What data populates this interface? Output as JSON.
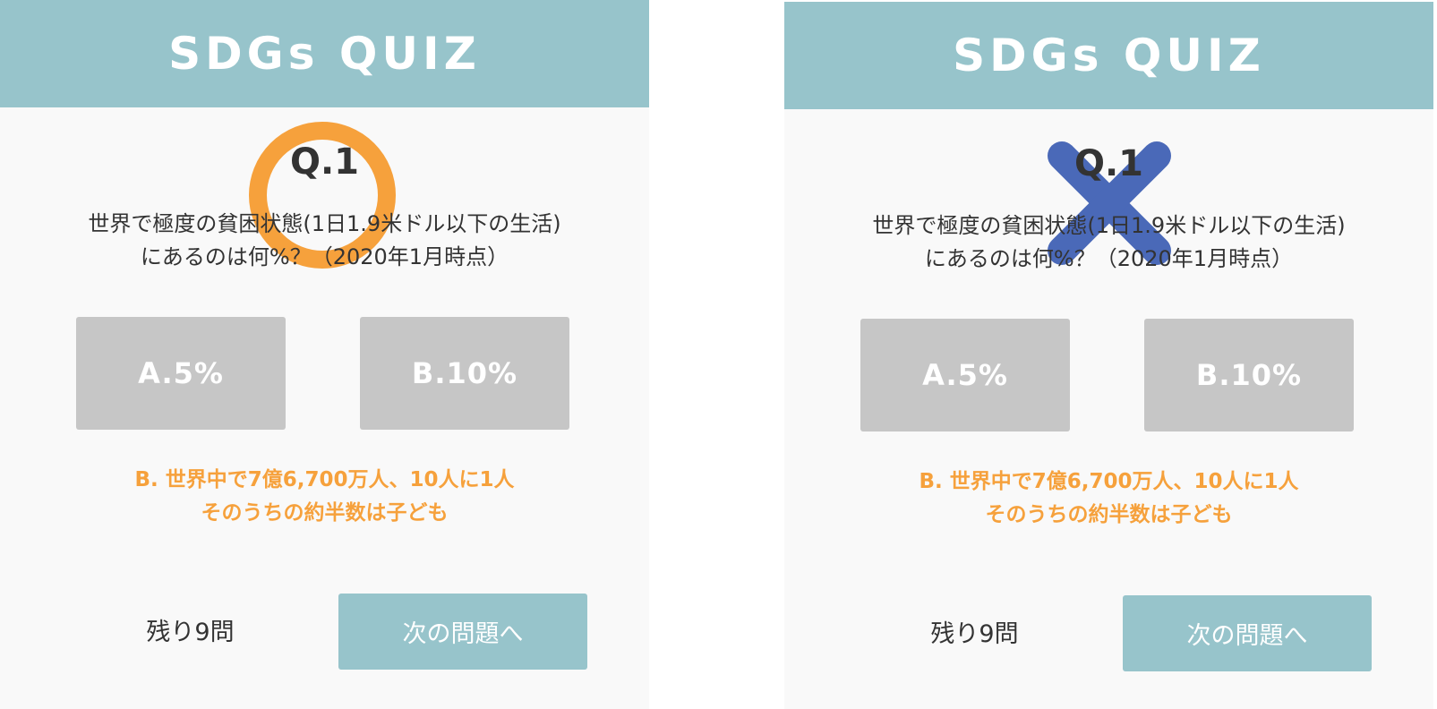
{
  "colors": {
    "header": "#97c4cb",
    "panel_bg": "#f9f9f9",
    "choice_bg": "#c6c6c6",
    "answer_text": "#f6a13c",
    "correct_mark": "#f6a13c",
    "wrong_mark": "#4a69b8"
  },
  "panels": [
    {
      "title": "SDGs QUIZ",
      "question_number": "Q.1",
      "question_lines": [
        "世界で極度の貧困状態(1日1.9米ドル以下の生活)",
        "にあるのは何%？（2020年1月時点）"
      ],
      "choices": [
        "A.5%",
        "B.10%"
      ],
      "answer_lines": [
        "B. 世界中で7億6,700万人、10人に1人",
        "そのうちの約半数は子ども"
      ],
      "remaining": "残り9問",
      "next_button": "次の問題へ",
      "result_icon": "circle-correct-icon"
    },
    {
      "title": "SDGs QUIZ",
      "question_number": "Q.1",
      "question_lines": [
        "世界で極度の貧困状態(1日1.9米ドル以下の生活)",
        "にあるのは何%？（2020年1月時点）"
      ],
      "choices": [
        "A.5%",
        "B.10%"
      ],
      "answer_lines": [
        "B. 世界中で7億6,700万人、10人に1人",
        "そのうちの約半数は子ども"
      ],
      "remaining": "残り9問",
      "next_button": "次の問題へ",
      "result_icon": "cross-wrong-icon"
    }
  ]
}
